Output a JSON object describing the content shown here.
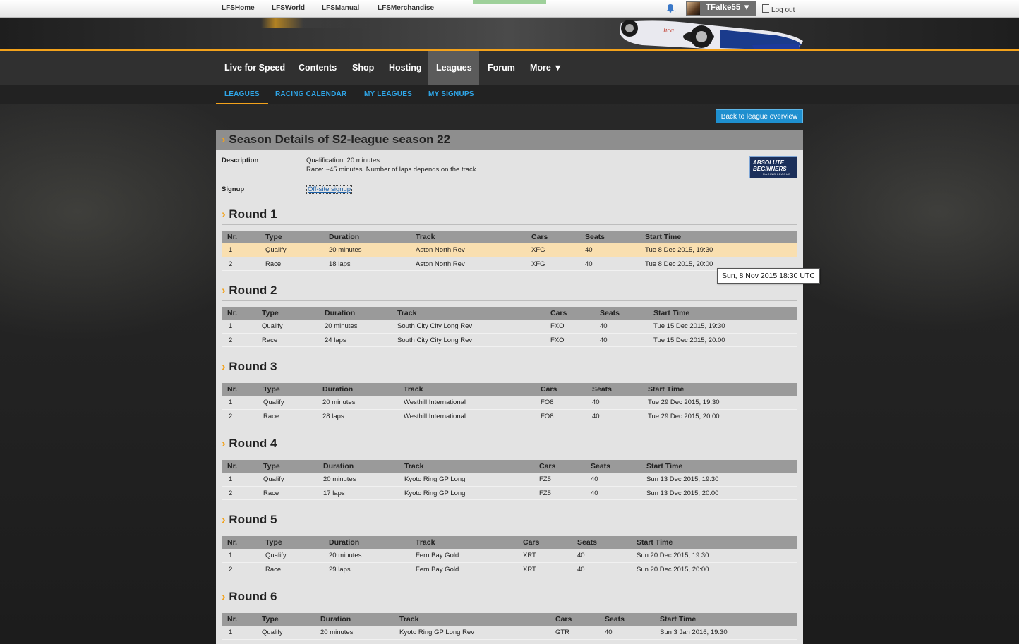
{
  "topbar": {
    "links": [
      "LFSHome",
      "LFSWorld",
      "LFSManual",
      "LFSMerchandise"
    ],
    "user": "TFalke55 ▼",
    "logout": "Log out"
  },
  "nav": {
    "items": [
      "Live for Speed",
      "Contents",
      "Shop",
      "Hosting",
      "Leagues",
      "Forum",
      "More ▼"
    ],
    "active": "Leagues"
  },
  "subnav": {
    "items": [
      "Leagues",
      "Racing Calendar",
      "My Leagues",
      "My Signups"
    ]
  },
  "back_button": "Back to league overview",
  "season": {
    "title": "Season Details of S2-league season 22",
    "description_label": "Description",
    "description_lines": [
      "Qualification: 20 minutes",
      "Race: ~45 minutes. Number of laps depends on the track."
    ],
    "signup_label": "Signup",
    "signup_link": "Off-site signup",
    "badge": {
      "line1": "ABSOLUTE",
      "line2": "BEGINNERS",
      "line3": "RACING LEAGUE"
    }
  },
  "columns": [
    "Nr.",
    "Type",
    "Duration",
    "Track",
    "Cars",
    "Seats",
    "Start Time"
  ],
  "rounds": [
    {
      "title": "Round 1",
      "rows": [
        [
          "1",
          "Qualify",
          "20 minutes",
          "Aston North Rev",
          "XFG",
          "40",
          "Tue 8 Dec 2015, 19:30"
        ],
        [
          "2",
          "Race",
          "18 laps",
          "Aston North Rev",
          "XFG",
          "40",
          "Tue 8 Dec 2015, 20:00"
        ]
      ]
    },
    {
      "title": "Round 2",
      "rows": [
        [
          "1",
          "Qualify",
          "20 minutes",
          "South City City Long Rev",
          "FXO",
          "40",
          "Tue 15 Dec 2015, 19:30"
        ],
        [
          "2",
          "Race",
          "24 laps",
          "South City City Long Rev",
          "FXO",
          "40",
          "Tue 15 Dec 2015, 20:00"
        ]
      ]
    },
    {
      "title": "Round 3",
      "rows": [
        [
          "1",
          "Qualify",
          "20 minutes",
          "Westhill International",
          "FO8",
          "40",
          "Tue 29 Dec 2015, 19:30"
        ],
        [
          "2",
          "Race",
          "28 laps",
          "Westhill International",
          "FO8",
          "40",
          "Tue 29 Dec 2015, 20:00"
        ]
      ]
    },
    {
      "title": "Round 4",
      "rows": [
        [
          "1",
          "Qualify",
          "20 minutes",
          "Kyoto Ring GP Long",
          "FZ5",
          "40",
          "Sun 13 Dec 2015, 19:30"
        ],
        [
          "2",
          "Race",
          "17 laps",
          "Kyoto Ring GP Long",
          "FZ5",
          "40",
          "Sun 13 Dec 2015, 20:00"
        ]
      ]
    },
    {
      "title": "Round 5",
      "rows": [
        [
          "1",
          "Qualify",
          "20 minutes",
          "Fern Bay Gold",
          "XRT",
          "40",
          "Sun 20 Dec 2015, 19:30"
        ],
        [
          "2",
          "Race",
          "29 laps",
          "Fern Bay Gold",
          "XRT",
          "40",
          "Sun 20 Dec 2015, 20:00"
        ]
      ]
    },
    {
      "title": "Round 6",
      "rows": [
        [
          "1",
          "Qualify",
          "20 minutes",
          "Kyoto Ring GP Long Rev",
          "GTR",
          "40",
          "Sun 3 Jan 2016, 19:30"
        ]
      ]
    }
  ],
  "tooltip": "Sun, 8 Nov 2015 18:30 UTC",
  "colors": {
    "accent": "#f3a21b",
    "link_blue": "#2fa6e8",
    "button_blue": "#1e8fcf",
    "highlight_row": "#f9dfb0"
  }
}
